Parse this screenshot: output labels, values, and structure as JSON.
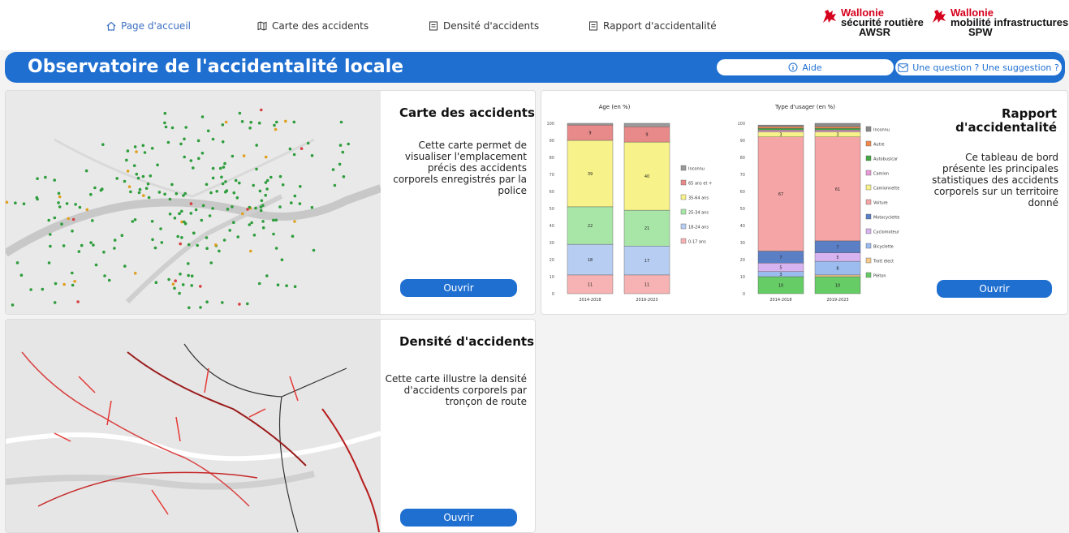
{
  "nav": {
    "home": "Page d'accueil",
    "map": "Carte des accidents",
    "density": "Densité d'accidents",
    "report": "Rapport d'accidentalité"
  },
  "logos": {
    "awsr": {
      "brand": "Wallonie",
      "line1": "sécurité routière",
      "line2": "AWSR"
    },
    "spw": {
      "brand": "Wallonie",
      "line1": "mobilité infrastructures",
      "line2": "SPW"
    }
  },
  "banner": {
    "title": "Observatoire de l'accidentalité locale",
    "help": "Aide",
    "question": "Une question ? Une suggestion ?"
  },
  "cards": {
    "map": {
      "title": "Carte des accidents",
      "desc": "Cette carte permet de visualiser l'emplacement précis des accidents corporels enregistrés par la police",
      "button": "Ouvrir"
    },
    "report": {
      "title": "Rapport d'accidentalité",
      "desc": "Ce tableau de bord présente les principales statistiques des accidents corporels sur un territoire donné",
      "button": "Ouvrir"
    },
    "density": {
      "title": "Densité d'accidents",
      "desc": "Cette carte illustre la densité d'accidents corporels par tronçon de route",
      "button": "Ouvrir"
    }
  },
  "colors": {
    "accent": "#1f6fd1",
    "brand_red": "#d6001c"
  },
  "chart_data": [
    {
      "type": "bar",
      "title": "Age (en %)",
      "stacked": true,
      "categories": [
        "2014-2018",
        "2019-2023"
      ],
      "ylim": [
        0,
        100
      ],
      "yticks": [
        0,
        10,
        20,
        30,
        40,
        50,
        60,
        70,
        80,
        90,
        100
      ],
      "series": [
        {
          "name": "0-17 ans",
          "color": "#f7b3b3",
          "values": [
            11,
            11
          ]
        },
        {
          "name": "18-24 ans",
          "color": "#b7cdf2",
          "values": [
            18,
            17
          ]
        },
        {
          "name": "25-34 ans",
          "color": "#a8e6a8",
          "values": [
            22,
            21
          ]
        },
        {
          "name": "35-64 ans",
          "color": "#f7f28a",
          "values": [
            39,
            40
          ]
        },
        {
          "name": "65 ans et +",
          "color": "#e88a8a",
          "values": [
            9,
            9
          ]
        },
        {
          "name": "Inconnu",
          "color": "#9a9a9a",
          "values": [
            1,
            2
          ]
        }
      ]
    },
    {
      "type": "bar",
      "title": "Type d'usager (en %)",
      "stacked": true,
      "categories": [
        "2014-2018",
        "2019-2023"
      ],
      "ylim": [
        0,
        100
      ],
      "yticks": [
        0,
        10,
        20,
        30,
        40,
        50,
        60,
        70,
        80,
        90,
        100
      ],
      "series": [
        {
          "name": "Piéton",
          "color": "#66cc66",
          "values": [
            10,
            10
          ]
        },
        {
          "name": "Trott élect",
          "color": "#f5c98a",
          "values": [
            0,
            1
          ]
        },
        {
          "name": "Bicyclette",
          "color": "#9cbcf0",
          "values": [
            3,
            8
          ]
        },
        {
          "name": "Cyclomoteur",
          "color": "#d7b3f0",
          "values": [
            5,
            5
          ]
        },
        {
          "name": "Motocyclette",
          "color": "#5b7fc4",
          "values": [
            7,
            7
          ]
        },
        {
          "name": "Voiture",
          "color": "#f5a5a5",
          "values": [
            67,
            61
          ]
        },
        {
          "name": "Camionnette",
          "color": "#f7f28a",
          "values": [
            3,
            3
          ]
        },
        {
          "name": "Camion",
          "color": "#e89ad8",
          "values": [
            1,
            1
          ]
        },
        {
          "name": "Autobus/car",
          "color": "#44a844",
          "values": [
            1,
            1
          ]
        },
        {
          "name": "Autre",
          "color": "#f08a50",
          "values": [
            1,
            1
          ]
        },
        {
          "name": "Inconnu",
          "color": "#8a8a8a",
          "values": [
            1,
            2
          ]
        }
      ],
      "labels": {
        "2014-2018": {
          "Piéton": "10",
          "Bicyclette": "3",
          "Cyclomoteur": "5",
          "Motocyclette": "7",
          "Voiture": "67",
          "Camionnette": "3"
        },
        "2019-2023": {
          "Piéton": "10",
          "Bicyclette": "8",
          "Cyclomoteur": "5",
          "Motocyclette": "7",
          "Voiture": "61",
          "Camionnette": "3"
        }
      }
    }
  ]
}
